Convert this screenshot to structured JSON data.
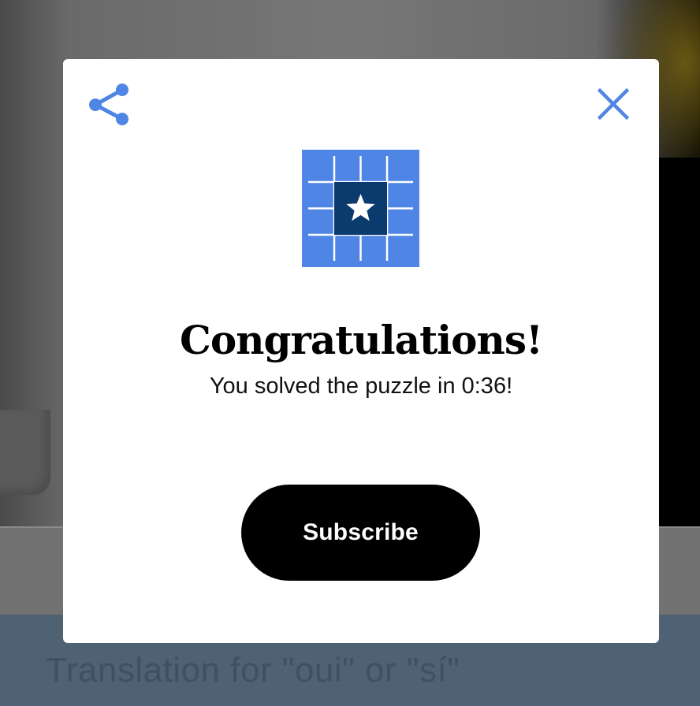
{
  "background": {
    "clue_text": "Translation for \"oui\" or \"sí\""
  },
  "modal": {
    "share_icon": "share-icon",
    "close_icon": "close-icon",
    "puzzle_icon": "mini-crossword-star-icon",
    "title": "Congratulations!",
    "message": "You solved the puzzle in 0:36!",
    "subscribe_label": "Subscribe"
  },
  "colors": {
    "accent_blue": "#4f85e5",
    "icon_dark_blue": "#0b3a6e",
    "button_black": "#000000",
    "clue_bar": "#4e6273"
  }
}
